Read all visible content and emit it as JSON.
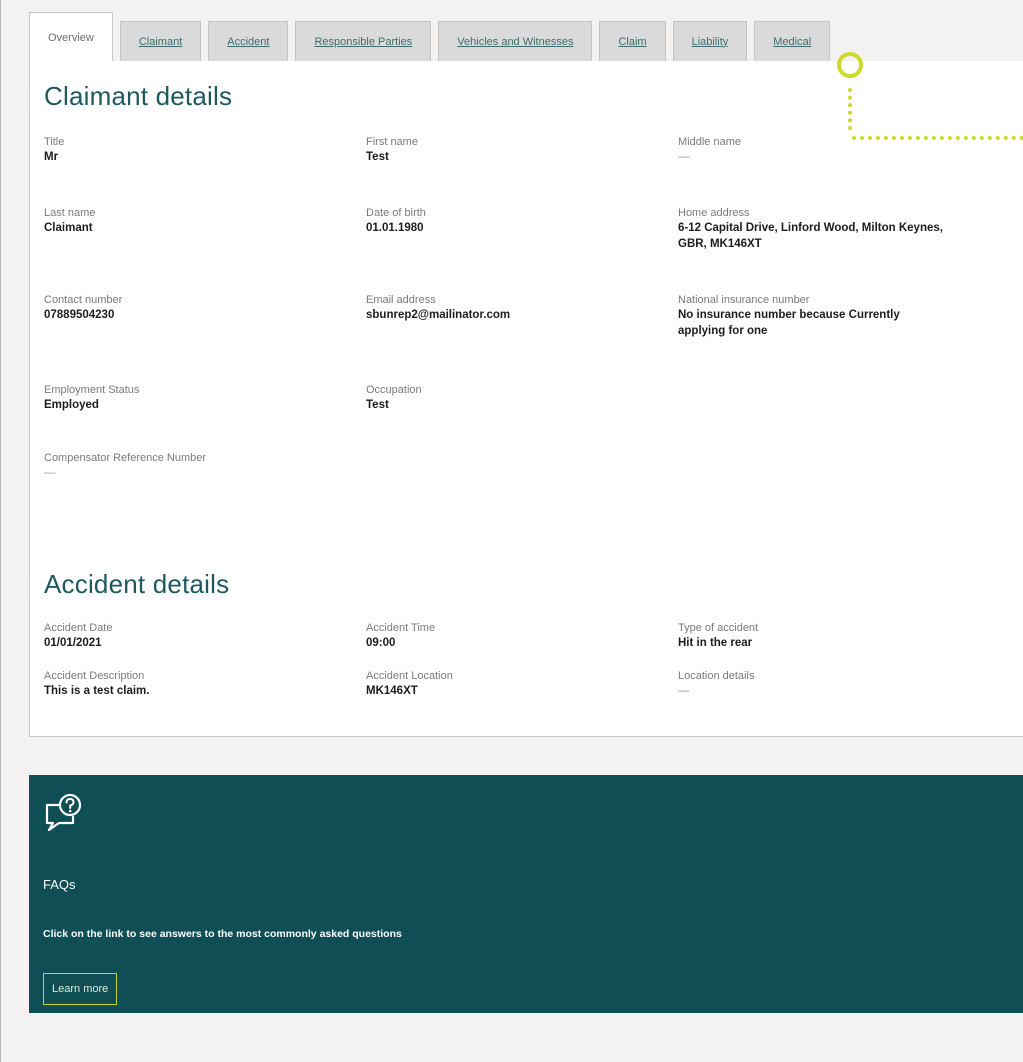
{
  "tabs": [
    {
      "label": "Overview",
      "active": true
    },
    {
      "label": "Claimant"
    },
    {
      "label": "Accident"
    },
    {
      "label": "Responsible Parties"
    },
    {
      "label": "Vehicles and Witnesses"
    },
    {
      "label": "Claim"
    },
    {
      "label": "Liability"
    },
    {
      "label": "Medical"
    }
  ],
  "claimant": {
    "heading": "Claimant details",
    "title_label": "Title",
    "title_value": "Mr",
    "first_name_label": "First name",
    "first_name_value": "Test",
    "middle_name_label": "Middle name",
    "middle_name_value": "—",
    "last_name_label": "Last name",
    "last_name_value": "Claimant",
    "dob_label": "Date of birth",
    "dob_value": "01.01.1980",
    "address_label": "Home address",
    "address_value": "6-12 Capital Drive, Linford Wood, Milton Keynes, GBR, MK146XT",
    "contact_label": "Contact number",
    "contact_value": "07889504230",
    "email_label": "Email address",
    "email_value": "sbunrep2@mailinator.com",
    "ni_label": "National insurance number",
    "ni_value": "No insurance number because Currently applying for one",
    "employment_label": "Employment Status",
    "employment_value": "Employed",
    "occupation_label": "Occupation",
    "occupation_value": "Test",
    "compensator_label": "Compensator Reference Number",
    "compensator_value": "—"
  },
  "accident": {
    "heading": "Accident details",
    "date_label": "Accident Date",
    "date_value": "01/01/2021",
    "time_label": "Accident Time",
    "time_value": "09:00",
    "type_label": "Type of accident",
    "type_value": "Hit in the rear",
    "description_label": "Accident Description",
    "description_value": "This is a test claim.",
    "location_label": "Accident Location",
    "location_value": "MK146XT",
    "location_details_label": "Location details",
    "location_details_value": "—"
  },
  "faq": {
    "icon": "question-speech-bubble-icon",
    "title": "FAQs",
    "description": "Click on the link to see answers to the most commonly asked questions",
    "button_label": "Learn more"
  },
  "colors": {
    "accent": "#1d5a5f",
    "faq_background": "#0e4e54",
    "highlight": "#cddc2b"
  }
}
